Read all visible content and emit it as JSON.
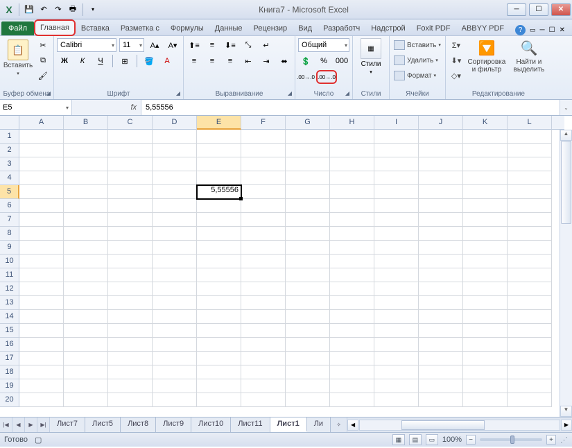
{
  "window": {
    "title": "Книга7  -  Microsoft Excel"
  },
  "qat": {
    "save": "💾",
    "undo": "↶",
    "redo": "↷",
    "print": "🖶"
  },
  "tabs": {
    "file": "Файл",
    "items": [
      "Главная",
      "Вставка",
      "Разметка с",
      "Формулы",
      "Данные",
      "Рецензир",
      "Вид",
      "Разработч",
      "Надстрой",
      "Foxit PDF",
      "ABBYY PDF"
    ],
    "active_index": 0
  },
  "ribbon": {
    "clipboard": {
      "paste": "Вставить",
      "label": "Буфер обмена"
    },
    "font": {
      "name": "Calibri",
      "size": "11",
      "bold": "Ж",
      "italic": "К",
      "underline": "Ч",
      "label": "Шрифт"
    },
    "alignment": {
      "label": "Выравнивание"
    },
    "number": {
      "format": "Общий",
      "label": "Число"
    },
    "styles": {
      "btn": "Стили",
      "label": "Стили"
    },
    "cells": {
      "insert": "Вставить",
      "delete": "Удалить",
      "format": "Формат",
      "label": "Ячейки"
    },
    "editing": {
      "sort": "Сортировка и фильтр",
      "find": "Найти и выделить",
      "label": "Редактирование"
    }
  },
  "namebox": "E5",
  "formula": "5,55556",
  "columns": [
    "A",
    "B",
    "C",
    "D",
    "E",
    "F",
    "G",
    "H",
    "I",
    "J",
    "K",
    "L"
  ],
  "rows": [
    "1",
    "2",
    "3",
    "4",
    "5",
    "6",
    "7",
    "8",
    "9",
    "10",
    "11",
    "12",
    "13",
    "14",
    "15",
    "16",
    "17",
    "18",
    "19",
    "20"
  ],
  "active_cell": {
    "row": 5,
    "col": 5,
    "value": "5,55556"
  },
  "sheets": {
    "list": [
      "Лист7",
      "Лист5",
      "Лист8",
      "Лист9",
      "Лист10",
      "Лист11",
      "Лист1"
    ],
    "more": "Ли",
    "active_index": 6
  },
  "status": {
    "ready": "Готово",
    "zoom": "100%"
  }
}
